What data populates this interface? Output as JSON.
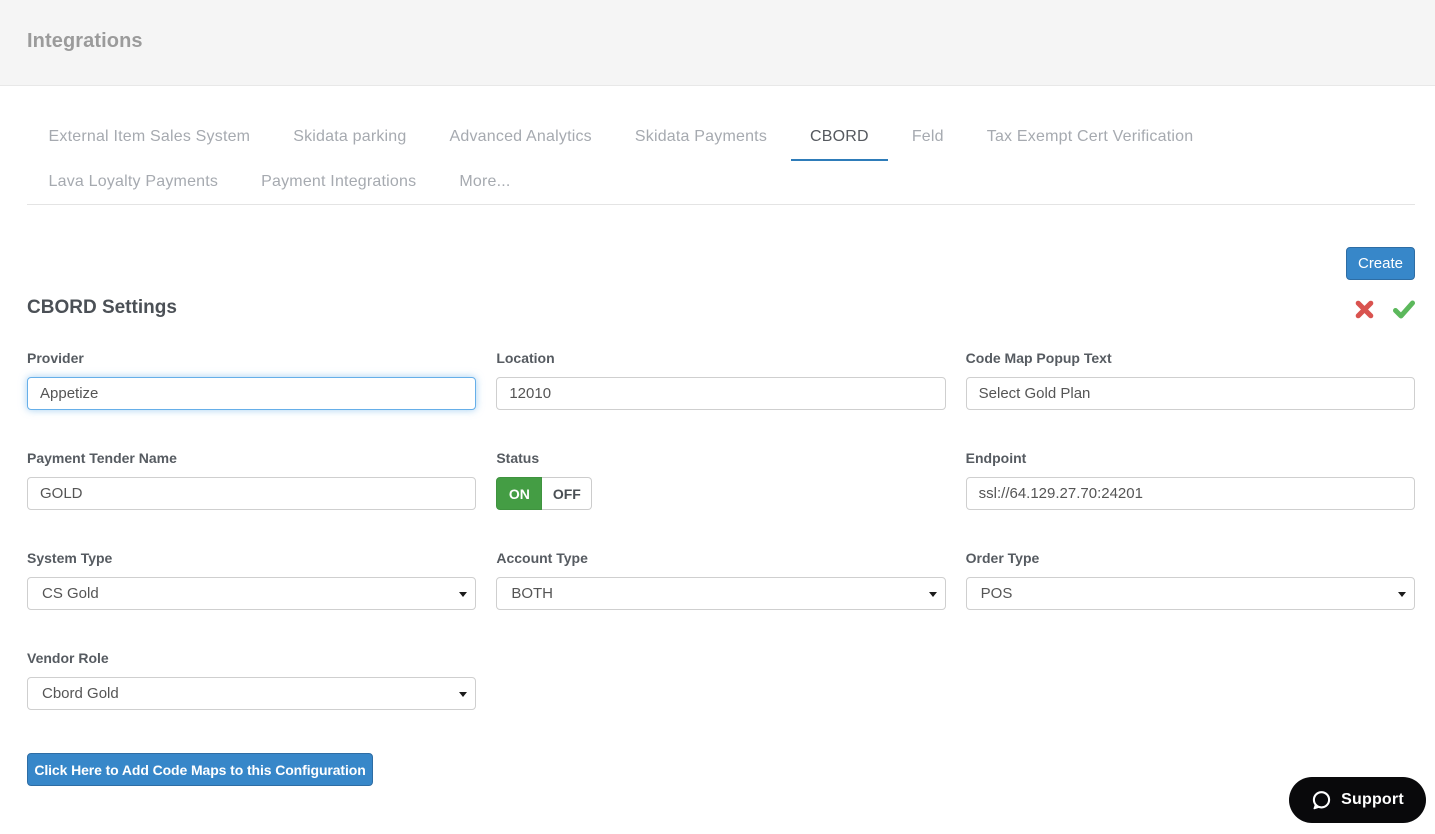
{
  "header": {
    "title": "Integrations"
  },
  "tabs": {
    "items": [
      {
        "label": "External Item Sales System"
      },
      {
        "label": "Skidata parking"
      },
      {
        "label": "Advanced Analytics"
      },
      {
        "label": "Skidata Payments"
      },
      {
        "label": "CBORD",
        "active": true
      },
      {
        "label": "Feld"
      },
      {
        "label": "Tax Exempt Cert Verification"
      },
      {
        "label": "Lava Loyalty Payments"
      },
      {
        "label": "Payment Integrations"
      },
      {
        "label": "More..."
      }
    ]
  },
  "toolbar": {
    "create_label": "Create"
  },
  "section": {
    "title": "CBORD Settings"
  },
  "form": {
    "provider": {
      "label": "Provider",
      "value": "Appetize"
    },
    "location": {
      "label": "Location",
      "value": "12010"
    },
    "code_map_popup_text": {
      "label": "Code Map Popup Text",
      "value": "Select Gold Plan"
    },
    "payment_tender_name": {
      "label": "Payment Tender Name",
      "value": "GOLD"
    },
    "status": {
      "label": "Status",
      "on_label": "ON",
      "off_label": "OFF",
      "value": "ON"
    },
    "endpoint": {
      "label": "Endpoint",
      "value": "ssl://64.129.27.70:24201"
    },
    "system_type": {
      "label": "System Type",
      "value": "CS Gold"
    },
    "account_type": {
      "label": "Account Type",
      "value": "BOTH"
    },
    "order_type": {
      "label": "Order Type",
      "value": "POS"
    },
    "vendor_role": {
      "label": "Vendor Role",
      "value": "Cbord Gold"
    }
  },
  "actions": {
    "add_code_maps_label": "Click Here to Add Code Maps to this Configuration"
  },
  "support": {
    "label": "Support"
  },
  "colors": {
    "accent_blue": "#3787c9",
    "tab_underline_blue": "#2e7cb9",
    "success_green": "#449d44",
    "check_green": "#5cb85c",
    "danger_red": "#d9534f",
    "header_bg": "#f5f5f5",
    "support_bg": "#09090b"
  }
}
